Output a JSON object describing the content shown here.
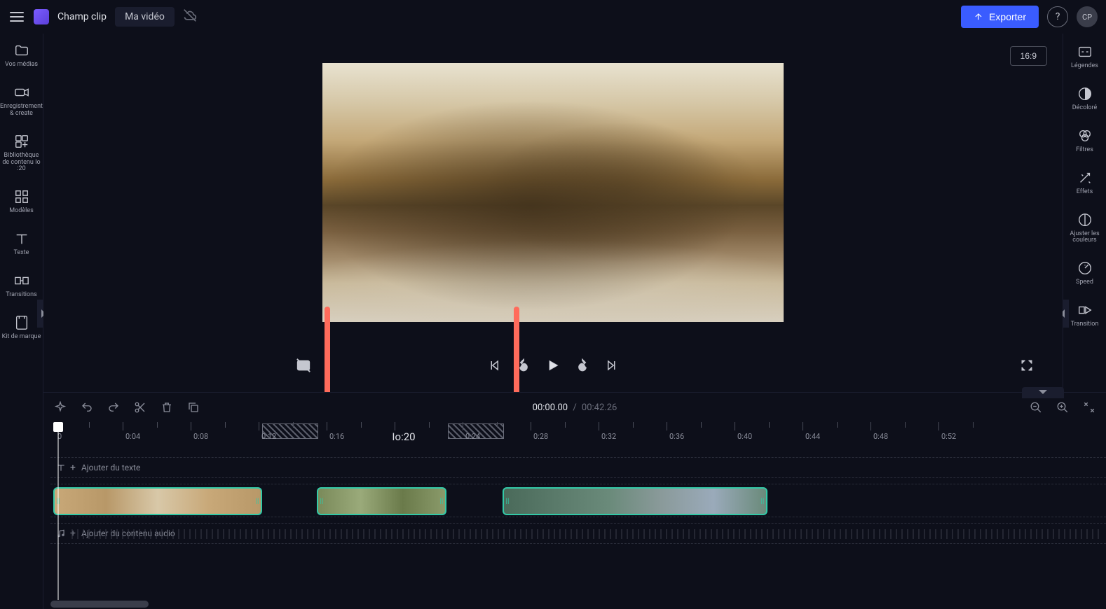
{
  "header": {
    "brand": "Champ clip",
    "project_name": "Ma vidéo",
    "export_label": "Exporter",
    "avatar_initials": "CP"
  },
  "left_sidebar": {
    "items": [
      {
        "id": "your-media",
        "label": "Vos médias"
      },
      {
        "id": "record-create",
        "label": "Enregistrement &amp; create"
      },
      {
        "id": "content-library",
        "label": "Bibliothèque de contenu Io :20"
      },
      {
        "id": "templates",
        "label": "Modèles"
      },
      {
        "id": "text",
        "label": "Texte"
      },
      {
        "id": "transitions",
        "label": "Transitions"
      },
      {
        "id": "brand-kit",
        "label": "Kit de marque"
      }
    ]
  },
  "right_sidebar": {
    "items": [
      {
        "id": "captions",
        "label": "Légendes"
      },
      {
        "id": "fade",
        "label": "Décoloré"
      },
      {
        "id": "filters",
        "label": "Filtres"
      },
      {
        "id": "effects",
        "label": "Effets"
      },
      {
        "id": "adjust-colors",
        "label": "Ajuster les couleurs"
      },
      {
        "id": "speed",
        "label": "Speed"
      },
      {
        "id": "transition",
        "label": "Transition"
      }
    ]
  },
  "preview": {
    "aspect_ratio": "16:9"
  },
  "timeline": {
    "current_time": "00:00.00",
    "total_time": "00:42.26",
    "center_label": "Io:20",
    "ruler_labels": [
      "0",
      "0:04",
      "0:08",
      "0:12",
      "0:16",
      "",
      "0:24",
      "0:28",
      "0:32",
      "0:36",
      "0:40",
      "0:44",
      "0:48",
      "0:52"
    ],
    "text_track_placeholder": "Ajouter du texte",
    "audio_track_placeholder": "Ajouter du contenu audio"
  }
}
